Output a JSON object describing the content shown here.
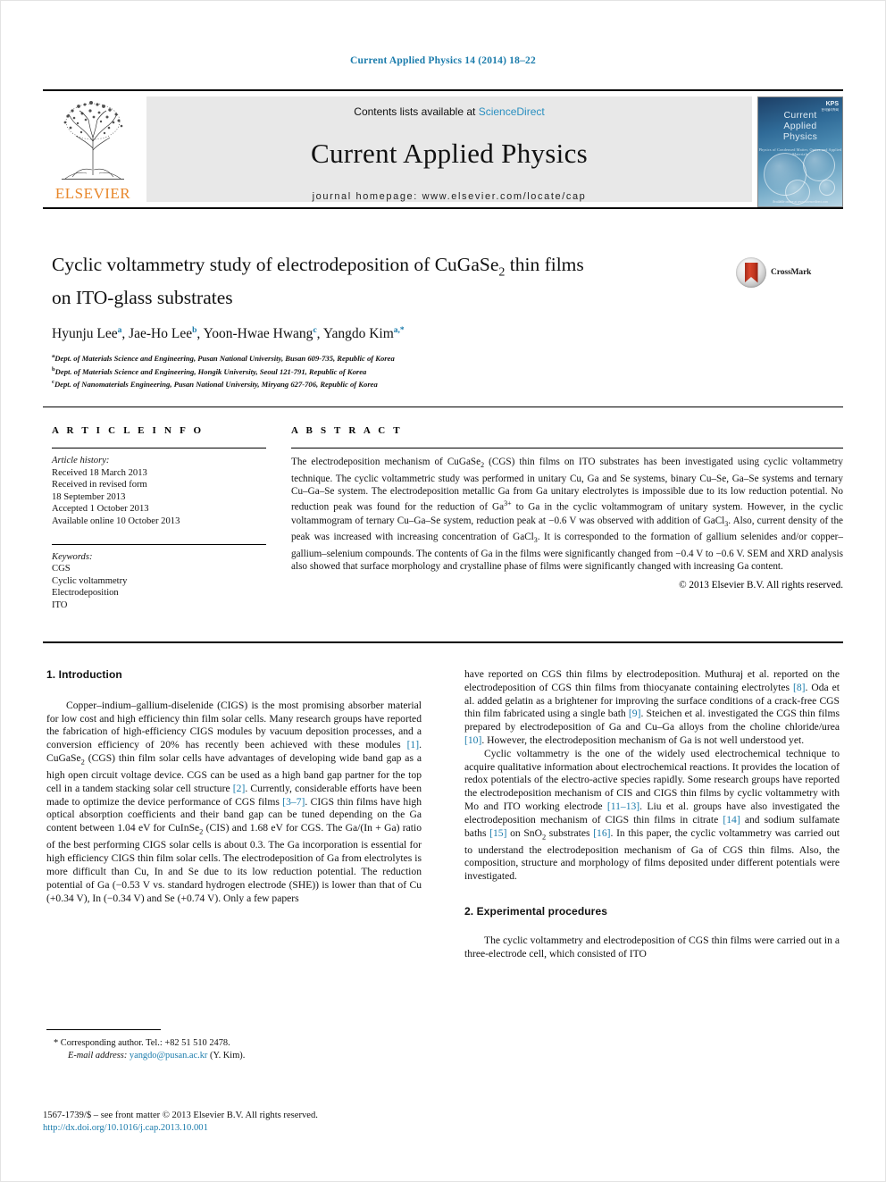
{
  "running_head": "Current Applied Physics 14 (2014) 18–22",
  "masthead": {
    "publisher_name": "ELSEVIER",
    "contents_prefix": "Contents lists available at ",
    "contents_link": "ScienceDirect",
    "journal_title": "Current Applied Physics",
    "homepage": "journal homepage: www.elsevier.com/locate/cap",
    "cover": {
      "line1": "Current",
      "line2": "Applied",
      "line3": "Physics",
      "subtitle": "Physics of Condensed Matter, Optics and Applied Materials",
      "badge": "KPS",
      "badge_sub": "한국물리학회",
      "footer": "Available online at www.sciencedirect.com"
    }
  },
  "article": {
    "title_line1": "Cyclic voltammetry study of electrodeposition of CuGaSe",
    "title_sub": "2",
    "title_line1_tail": " thin films",
    "title_line2": "on ITO-glass substrates",
    "crossmark_label": "CrossMark",
    "authors": [
      {
        "name": "Hyunju Lee",
        "marks": "a"
      },
      {
        "name": "Jae-Ho Lee",
        "marks": "b"
      },
      {
        "name": "Yoon-Hwae Hwang",
        "marks": "c"
      },
      {
        "name": "Yangdo Kim",
        "marks": "a,*"
      }
    ],
    "affiliations": [
      {
        "mark": "a",
        "text": "Dept. of Materials Science and Engineering, Pusan National University, Busan 609-735, Republic of Korea"
      },
      {
        "mark": "b",
        "text": "Dept. of Materials Science and Engineering, Hongik University, Seoul 121-791, Republic of Korea"
      },
      {
        "mark": "c",
        "text": "Dept. of Nanomaterials Engineering, Pusan National University, Miryang 627-706, Republic of Korea"
      }
    ]
  },
  "article_info": {
    "heading": "A R T I C L E   I N F O",
    "history_label": "Article history:",
    "history": [
      "Received 18 March 2013",
      "Received in revised form",
      "18 September 2013",
      "Accepted 1 October 2013",
      "Available online 10 October 2013"
    ],
    "keywords_label": "Keywords:",
    "keywords": [
      "CGS",
      "Cyclic voltammetry",
      "Electrodeposition",
      "ITO"
    ]
  },
  "abstract": {
    "heading": "A B S T R A C T",
    "text_p1": "The electrodeposition mechanism of CuGaSe",
    "sub1": "2",
    "text_p2": " (CGS) thin films on ITO substrates has been investigated using cyclic voltammetry technique. The cyclic voltammetric study was performed in unitary Cu, Ga and Se systems, binary Cu–Se, Ga–Se systems and ternary Cu–Ga–Se system. The electrodeposition metallic Ga from Ga unitary electrolytes is impossible due to its low reduction potential. No reduction peak was found for the reduction of Ga",
    "sup1": "3+",
    "text_p3": " to Ga in the cyclic voltammogram of unitary system. However, in the cyclic voltammogram of ternary Cu–Ga–Se system, reduction peak at −0.6 V was observed with addition of GaCl",
    "sub2": "3",
    "text_p4": ". Also, current density of the peak was increased with increasing concentration of GaCl",
    "sub3": "3",
    "text_p5": ". It is corresponded to the formation of gallium selenides and/or copper–gallium–selenium compounds. The contents of Ga in the films were significantly changed from −0.4 V to −0.6 V. SEM and XRD analysis also showed that surface morphology and crystalline phase of films were significantly changed with increasing Ga content.",
    "copyright": "© 2013 Elsevier B.V. All rights reserved."
  },
  "sections": {
    "introduction_heading": "1.  Introduction",
    "experimental_heading": "2.  Experimental procedures"
  },
  "body": {
    "left_p1_a": "Copper–indium–gallium-diselenide (CIGS) is the most promising absorber material for low cost and high efficiency thin film solar cells. Many research groups have reported the fabrication of high-efficiency CIGS modules by vacuum deposition processes, and a conversion efficiency of 20% has recently been achieved with these modules ",
    "ref1": "[1]",
    "left_p1_b": ". CuGaSe",
    "sub_2": "2",
    "left_p1_c": " (CGS) thin film solar cells have advantages of developing wide band gap as a high open circuit voltage device. CGS can be used as a high band gap partner for the top cell in a tandem stacking solar cell structure ",
    "ref2": "[2]",
    "left_p1_d": ". Currently, considerable efforts have been made to optimize the device performance of CGS films ",
    "ref3": "[3–7]",
    "left_p1_e": ". CIGS thin films have high optical absorption coefficients and their band gap can be tuned depending on the Ga content between 1.04 eV for CuInSe",
    "sub_2b": "2",
    "left_p1_f": " (CIS) and 1.68 eV for CGS. The Ga/(In + Ga) ratio of the best performing CIGS solar cells is about 0.3. The Ga incorporation is essential for high efficiency CIGS thin film solar cells. The electrodeposition of Ga from electrolytes is more difficult than Cu, In and Se due to its low reduction potential. The reduction potential of Ga (−0.53 V vs. standard hydrogen electrode (SHE)) is lower than that of Cu (+0.34 V), In (−0.34 V) and Se (+0.74 V). Only a few papers",
    "right_p1_a": "have reported on CGS thin films by electrodeposition. Muthuraj et al. reported on the electrodeposition of CGS thin films from thiocyanate containing electrolytes ",
    "ref8": "[8]",
    "right_p1_b": ". Oda et al. added gelatin as a brightener for improving the surface conditions of a crack-free CGS thin film fabricated using a single bath ",
    "ref9": "[9]",
    "right_p1_c": ". Steichen et al. investigated the CGS thin films prepared by electrodeposition of Ga and Cu–Ga alloys from the choline chloride/urea ",
    "ref10": "[10]",
    "right_p1_d": ". However, the electrodeposition mechanism of Ga is not well understood yet.",
    "right_p2_a": "Cyclic voltammetry is the one of the widely used electrochemical technique to acquire qualitative information about electrochemical reactions. It provides the location of redox potentials of the electro-active species rapidly. Some research groups have reported the electrodeposition mechanism of CIS and CIGS thin films by cyclic voltammetry with Mo and ITO working electrode ",
    "ref11": "[11–13]",
    "right_p2_b": ". Liu et al. groups have also investigated the electrodeposition mechanism of CIGS thin films in citrate ",
    "ref14": "[14]",
    "right_p2_c": " and sodium sulfamate baths ",
    "ref15": "[15]",
    "right_p2_d": " on SnO",
    "sub_sno2": "2",
    "right_p2_e": " substrates ",
    "ref16": "[16]",
    "right_p2_f": ". In this paper, the cyclic voltammetry was carried out to understand the electrodeposition mechanism of Ga of CGS thin films. Also, the composition, structure and morphology of films deposited under different potentials were investigated.",
    "right_p3": "The cyclic voltammetry and electrodeposition of CGS thin films were carried out in a three-electrode cell, which consisted of ITO"
  },
  "footnote": {
    "corresponding": "* Corresponding author. Tel.: +82 51 510 2478.",
    "email_label": "E-mail address:",
    "email": "yangdo@pusan.ac.kr",
    "email_suffix": "(Y. Kim)."
  },
  "bottom": {
    "issn_line": "1567-1739/$ – see front matter © 2013 Elsevier B.V. All rights reserved.",
    "doi": "http://dx.doi.org/10.1016/j.cap.2013.10.001"
  },
  "colors": {
    "link_blue": "#1a7bab",
    "elsevier_orange": "#e8872b",
    "sciencedirect_blue": "#2a8fc0",
    "band_grey": "#e8e8e8"
  }
}
